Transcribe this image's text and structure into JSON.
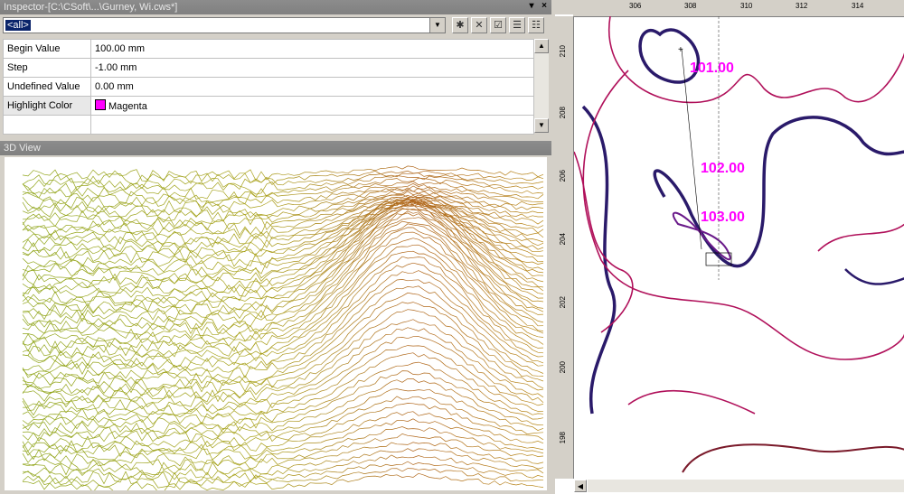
{
  "inspector": {
    "title": "Inspector-[C:\\CSoft\\...\\Gurney, Wi.cws*]",
    "filter_value": "<all>",
    "properties": [
      {
        "name": "Begin Value",
        "value": "100.00 mm"
      },
      {
        "name": "Step",
        "value": "-1.00 mm"
      },
      {
        "name": "Undefined Value",
        "value": "0.00 mm"
      },
      {
        "name": "Highlight Color",
        "value": "Magenta"
      }
    ],
    "highlight_color_hex": "#ff00ff"
  },
  "view3d": {
    "title": "3D View"
  },
  "map": {
    "ruler_x": [
      "306",
      "308",
      "310",
      "312",
      "314"
    ],
    "ruler_y": [
      "210",
      "208",
      "206",
      "204",
      "202",
      "200",
      "198"
    ],
    "labels": [
      "101.00",
      "102.00",
      "103.00"
    ],
    "label_color": "#ff00ff"
  },
  "icons": [
    "minimize-icon",
    "close-icon",
    "dropdown-arrow-icon",
    "new-icon",
    "delete-icon",
    "check-icon",
    "list-icon",
    "details-icon"
  ]
}
